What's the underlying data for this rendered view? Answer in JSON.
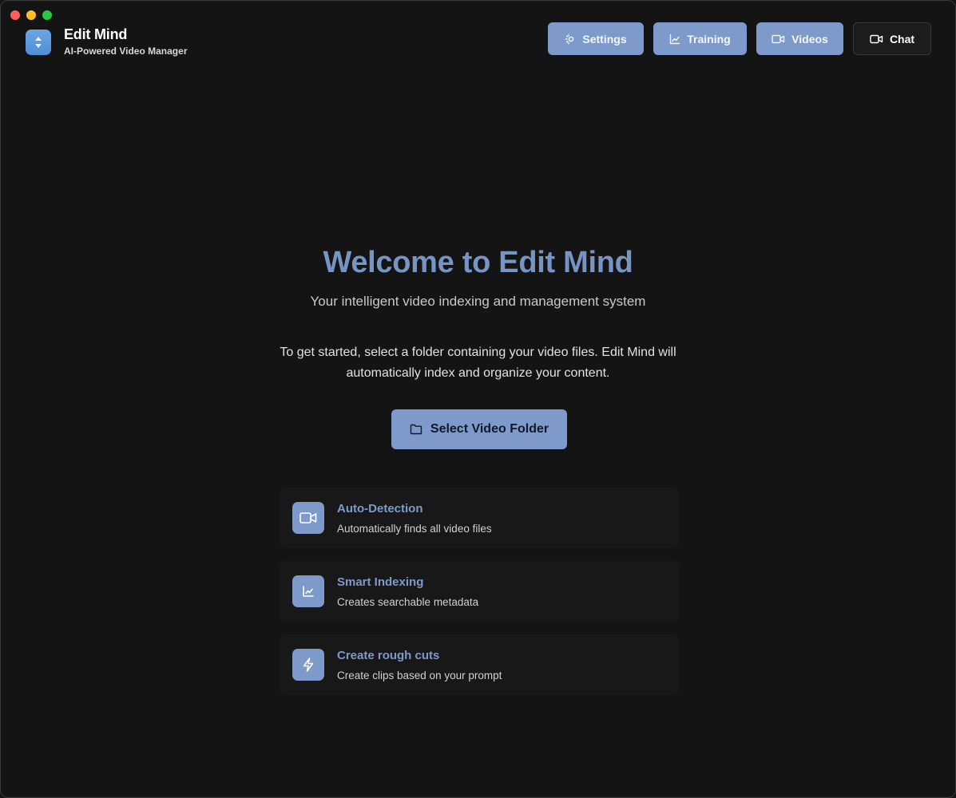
{
  "app": {
    "title": "Edit Mind",
    "subtitle": "AI-Powered Video Manager",
    "logo_icon": "up-down-arrows-icon",
    "accent": "#7d9acb",
    "heading_color": "#7694c4",
    "background": "#141414"
  },
  "nav": {
    "settings": {
      "label": "Settings",
      "icon": "sun-settings-icon"
    },
    "training": {
      "label": "Training",
      "icon": "chart-line-icon"
    },
    "videos": {
      "label": "Videos",
      "icon": "video-camera-icon"
    },
    "chat": {
      "label": "Chat",
      "icon": "video-camera-icon"
    }
  },
  "hero": {
    "title": "Welcome to Edit Mind",
    "subtitle": "Your intelligent video indexing and management system",
    "description": "To get started, select a folder containing your video files. Edit Mind will automatically index and organize your content."
  },
  "cta": {
    "label": "Select Video Folder",
    "icon": "folder-icon"
  },
  "features": [
    {
      "title": "Auto-Detection",
      "description": "Automatically finds all video files",
      "icon": "video-camera-icon"
    },
    {
      "title": "Smart Indexing",
      "description": "Creates searchable metadata",
      "icon": "chart-line-icon"
    },
    {
      "title": "Create rough cuts",
      "description": "Create clips based on your prompt",
      "icon": "lightning-icon"
    }
  ]
}
